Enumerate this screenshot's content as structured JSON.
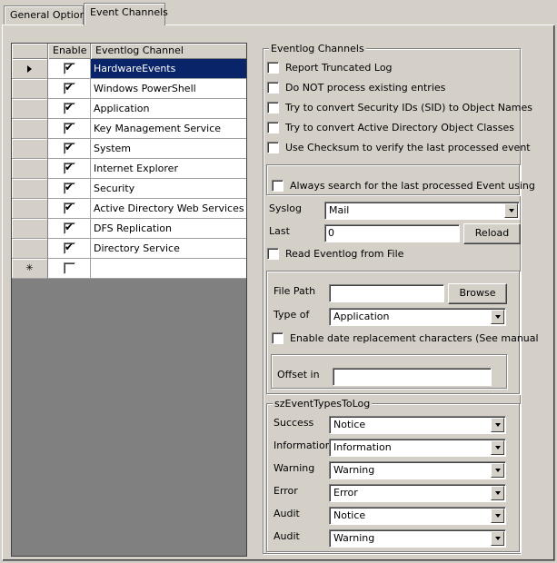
{
  "tabs": [
    {
      "label": "General Options"
    },
    {
      "label": "Event Channels"
    }
  ],
  "grid": {
    "columns": [
      "",
      "Enable",
      "Eventlog Channel"
    ],
    "rows": [
      {
        "name": "HardwareEvents",
        "enabled": true,
        "selected": true
      },
      {
        "name": "Windows PowerShell",
        "enabled": true
      },
      {
        "name": "Application",
        "enabled": true
      },
      {
        "name": "Key Management Service",
        "enabled": true
      },
      {
        "name": "System",
        "enabled": true
      },
      {
        "name": "Internet Explorer",
        "enabled": true
      },
      {
        "name": "Security",
        "enabled": true
      },
      {
        "name": "Active Directory Web Services",
        "enabled": true
      },
      {
        "name": "DFS Replication",
        "enabled": true
      },
      {
        "name": "Directory Service",
        "enabled": true
      },
      {
        "name": "",
        "enabled": false,
        "new_row": true
      }
    ]
  },
  "eventlog_channels": {
    "legend": "Eventlog Channels",
    "options": [
      {
        "label": "Report Truncated Log",
        "checked": false
      },
      {
        "label": "Do NOT process existing entries",
        "checked": false
      },
      {
        "label": "Try to convert Security IDs (SID) to Object Names",
        "checked": false
      },
      {
        "label": "Try to convert Active Directory Object Classes",
        "checked": false
      },
      {
        "label": "Use Checksum to verify the last processed event",
        "checked": false
      }
    ],
    "always_search": {
      "label": "Always search for the last processed Event using",
      "checked": false
    },
    "syslog": {
      "label": "Syslog",
      "value": "Mail"
    },
    "last": {
      "label": "Last",
      "value": "0",
      "reload_label": "Reload"
    },
    "read_from_file": {
      "label": "Read Eventlog from File",
      "checked": false
    },
    "file": {
      "path_label": "File  Path",
      "path_value": "",
      "browse_label": "Browse",
      "type_label": "Type of",
      "type_value": "Application",
      "date_replace": {
        "label": "Enable date replacement characters (See manual",
        "checked": false
      },
      "offset_label": "Offset in",
      "offset_value": ""
    }
  },
  "event_types": {
    "legend": "szEventTypesToLog",
    "items": [
      {
        "label": "Success",
        "value": "Notice"
      },
      {
        "label": "Information",
        "value": "Information"
      },
      {
        "label": "Warning",
        "value": "Warning"
      },
      {
        "label": "Error",
        "value": "Error"
      },
      {
        "label": "Audit",
        "value": "Notice"
      },
      {
        "label": "Audit",
        "value": "Warning"
      }
    ]
  },
  "icons": {
    "row_indicator": "triangle-right-icon",
    "new_row": "asterisk-icon",
    "checkmark": "checkmark-icon",
    "dropdown": "chevron-down-icon"
  },
  "colors": {
    "window_bg": "#d4d0c8",
    "selection_bg": "#0a246a",
    "grid_bg": "#808080"
  }
}
